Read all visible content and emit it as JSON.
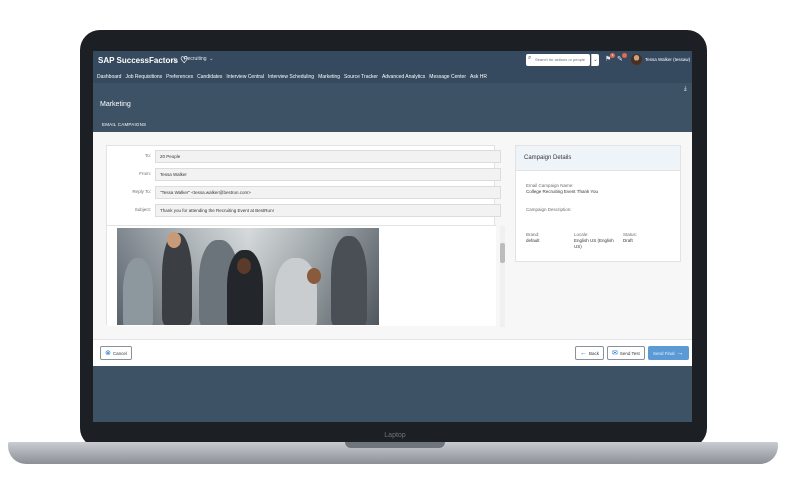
{
  "shell": {
    "logo": "SAP SuccessFactors",
    "module": "Recruiting",
    "search_placeholder": "Search for actions or people",
    "notif_count": "1",
    "user": "Tessa Walker (tessaw)"
  },
  "nav": [
    "Dashboard",
    "Job Requisitions",
    "Preferences",
    "Candidates",
    "Interview Central",
    "Interview Scheduling",
    "Marketing",
    "Source Tracker",
    "Advanced Analytics",
    "Message Center",
    "Ask HR"
  ],
  "page": {
    "title": "Marketing",
    "tab": "EMAIL CAMPAIGNS"
  },
  "email": {
    "to_label": "To:",
    "to_value": "20 People",
    "from_label": "From:",
    "from_value": "Tessa Walker",
    "reply_label": "Reply To:",
    "reply_value": "\"Tessa Walker\" <tessa.walker@bestrun.com>",
    "subject_label": "Subject:",
    "subject_value": "Thank you for attending the Recruiting Event at BestRun!"
  },
  "campaign": {
    "title": "Campaign Details",
    "name_label": "Email Campaign Name:",
    "name_value": "College Recruiting Event Thank You",
    "desc_label": "Campaign Description:",
    "brand_label": "Brand:",
    "brand_value": "default",
    "locale_label": "Locale:",
    "locale_value": "English US (English US)",
    "status_label": "Status:",
    "status_value": "Draft"
  },
  "actions": {
    "cancel": "Cancel",
    "back": "Back",
    "send_test": "Send Test",
    "send_final": "Send Final"
  },
  "device": {
    "label": "Laptop"
  }
}
